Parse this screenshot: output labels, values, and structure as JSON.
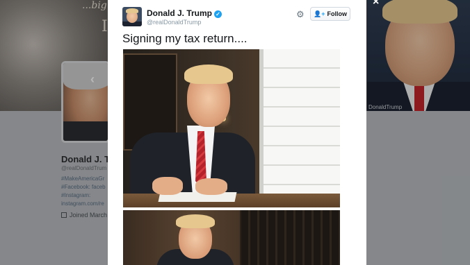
{
  "background": {
    "banner_script": "...big",
    "banner_letter": "I",
    "right_caption": "DonaldTrump",
    "profile_name": "Donald J. T",
    "profile_handle": "@realDonaldTrum",
    "bio_lines": [
      "#MakeAmericaGr",
      "#Facebook: faceb",
      "#Instagram:",
      "instagram.com/re"
    ],
    "joined": "Joined March"
  },
  "close_label": "×",
  "tweet": {
    "display_name": "Donald J. Trump",
    "verified_glyph": "✓",
    "screen_name": "@realDonaldTrump",
    "gear_glyph": "⚙",
    "follow_label": "Follow",
    "follow_icon": "👤+",
    "text": "Signing my tax return...."
  },
  "icons": {
    "prev_chevron": "‹"
  },
  "colors": {
    "accent": "#1da1f2",
    "modal_bg": "#ffffff",
    "text": "#14171a",
    "muted": "#8899a6"
  }
}
